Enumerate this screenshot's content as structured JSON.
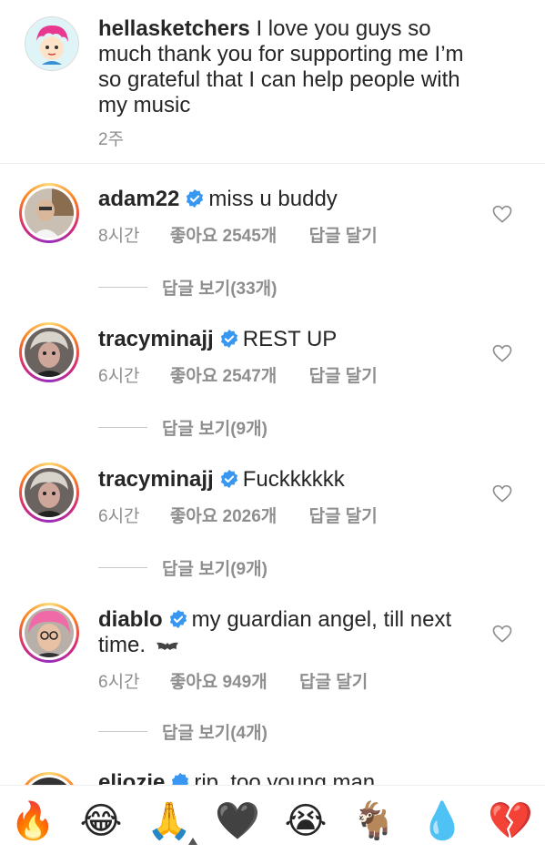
{
  "caption": {
    "username": "hellasketchers",
    "text": " I love you guys so much thank you for supporting me I’m so grateful that I can help people with my music",
    "time": "2주"
  },
  "comments": [
    {
      "username": "adam22",
      "text": "miss u buddy",
      "text2": "",
      "time": "8시간",
      "likes": "좋아요 2545개",
      "reply": "답글 달기",
      "view_replies": "답글 보기(33개)"
    },
    {
      "username": "tracyminajj",
      "text": "REST UP",
      "text2": "",
      "time": "6시간",
      "likes": "좋아요 2547개",
      "reply": "답글 달기",
      "view_replies": "답글 보기(9개)"
    },
    {
      "username": "tracyminajj",
      "text": "Fuckkkkkk",
      "text2": "",
      "time": "6시간",
      "likes": "좋아요 2026개",
      "reply": "답글 달기",
      "view_replies": "답글 보기(9개)"
    },
    {
      "username": "diablo",
      "text": "my guardian angel, till next",
      "text2": "time.",
      "time": "6시간",
      "likes": "좋아요 949개",
      "reply": "답글 달기",
      "view_replies": "답글 보기(4개)"
    }
  ],
  "peek": {
    "username": "eliozie",
    "text": "rip, too young man"
  },
  "emoji_bar": [
    {
      "name": "fire-emoji",
      "glyph": "🔥"
    },
    {
      "name": "tears-of-joy-emoji",
      "glyph": "😂"
    },
    {
      "name": "folded-hands-emoji",
      "glyph": "🙏"
    },
    {
      "name": "black-heart-emoji",
      "glyph": "🖤"
    },
    {
      "name": "crying-face-emoji",
      "glyph": "😭"
    },
    {
      "name": "goat-emoji",
      "glyph": "🐐"
    },
    {
      "name": "droplet-emoji",
      "glyph": "💧"
    },
    {
      "name": "broken-heart-emoji",
      "glyph": "💔"
    }
  ],
  "colors": {
    "text": "#262626",
    "muted": "#8e8e8e",
    "verified": "#3897f0",
    "divider": "#efefef"
  }
}
